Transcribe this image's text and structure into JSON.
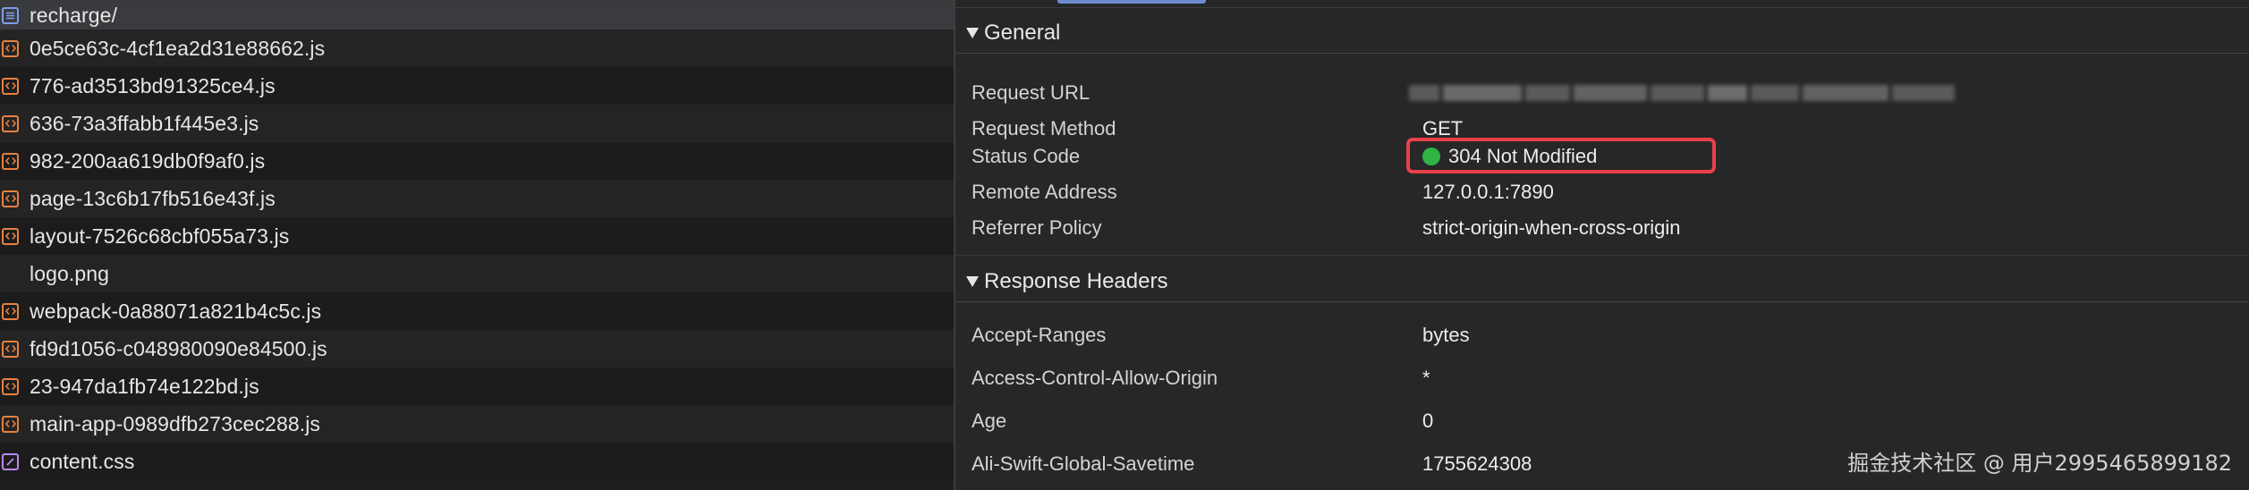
{
  "requests": [
    {
      "name": "recharge/",
      "type": "document"
    },
    {
      "name": "0e5ce63c-4cf1ea2d31e88662.js",
      "type": "script"
    },
    {
      "name": "776-ad3513bd91325ce4.js",
      "type": "script"
    },
    {
      "name": "636-73a3ffabb1f445e3.js",
      "type": "script"
    },
    {
      "name": "982-200aa619db0f9af0.js",
      "type": "script"
    },
    {
      "name": "page-13c6b17fb516e43f.js",
      "type": "script"
    },
    {
      "name": "layout-7526c68cbf055a73.js",
      "type": "script"
    },
    {
      "name": "logo.png",
      "type": "image"
    },
    {
      "name": "webpack-0a88071a821b4c5c.js",
      "type": "script"
    },
    {
      "name": "fd9d1056-c048980090e84500.js",
      "type": "script"
    },
    {
      "name": "23-947da1fb74e122bd.js",
      "type": "script"
    },
    {
      "name": "main-app-0989dfb273cec288.js",
      "type": "script"
    },
    {
      "name": "content.css",
      "type": "stylesheet"
    }
  ],
  "general": {
    "title": "General",
    "rows": [
      {
        "key": "Request URL",
        "value": ""
      },
      {
        "key": "Request Method",
        "value": "GET"
      },
      {
        "key": "Status Code",
        "value": "304 Not Modified"
      },
      {
        "key": "Remote Address",
        "value": "127.0.0.1:7890"
      },
      {
        "key": "Referrer Policy",
        "value": "strict-origin-when-cross-origin"
      }
    ]
  },
  "response_headers": {
    "title": "Response Headers",
    "rows": [
      {
        "key": "Accept-Ranges",
        "value": "bytes"
      },
      {
        "key": "Access-Control-Allow-Origin",
        "value": "*"
      },
      {
        "key": "Age",
        "value": "0"
      },
      {
        "key": "Ali-Swift-Global-Savetime",
        "value": "1755624308"
      }
    ]
  },
  "watermark": "掘金技术社区 @ 用户2995465899182",
  "colors": {
    "status_ok": "#2fb344",
    "highlight": "#e9404a",
    "script_icon": "#e8813f",
    "document_icon": "#7c9ff2",
    "stylesheet_icon": "#b889f0",
    "active_tab": "#6d8ccf"
  },
  "icons": {
    "document": "document-icon",
    "script": "script-icon",
    "stylesheet": "stylesheet-icon",
    "image": "image-icon"
  }
}
